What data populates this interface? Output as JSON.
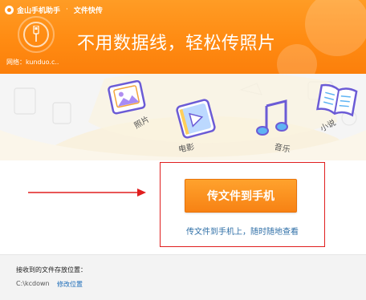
{
  "window": {
    "app_name": "金山手机助手",
    "separator": "·",
    "section": "文件快传"
  },
  "header": {
    "network_label": "网络：kunduo.c..",
    "slogan": "不用数据线，轻松传照片"
  },
  "categories": [
    {
      "label": "照片",
      "icon": "photo-icon"
    },
    {
      "label": "电影",
      "icon": "video-icon"
    },
    {
      "label": "音乐",
      "icon": "music-icon"
    },
    {
      "label": "小说",
      "icon": "book-icon"
    }
  ],
  "main": {
    "send_button": "传文件到手机",
    "send_hint": "传文件到手机上，随时随地查看"
  },
  "footer": {
    "receive_location_label": "接收到的文件存放位置：",
    "path": "C:\\kcdown",
    "modify_link": "修改位置"
  },
  "colors": {
    "header_orange": "#ff8b12",
    "button_orange": "#f78214",
    "highlight_red": "#e01e1e",
    "link_blue": "#1a6bb8"
  }
}
